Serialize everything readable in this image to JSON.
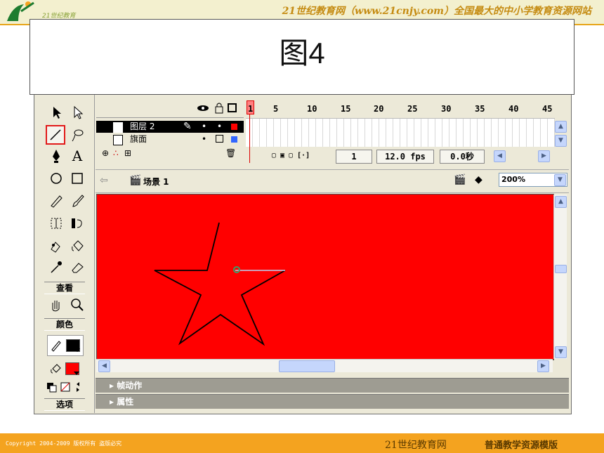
{
  "slide": {
    "banner": "21世纪教育网（www.21cnjy.com）全国最大的中小学教育资源网站",
    "logo_text": "21世纪教育",
    "figure_title": "图4",
    "footer_copyright": "Copyright 2004-2009 版权所有 盗版必究",
    "footer_site": "21世纪教育网",
    "footer_template": "普通教学资源模版"
  },
  "tools": {
    "view_label": "查看",
    "colors_label": "颜色",
    "options_label": "选项",
    "text_tool_glyph": "A",
    "stroke_color": "#000000",
    "fill_color": "#ff0000",
    "selected_tool": "line-tool"
  },
  "timeline": {
    "frame_numbers": [
      "1",
      "5",
      "10",
      "15",
      "20",
      "25",
      "30",
      "35",
      "40",
      "45"
    ],
    "layers": [
      {
        "name": "图层 2",
        "selected": true,
        "color": "#ff0000"
      },
      {
        "name": "旗面",
        "selected": false,
        "color": "#3366ff"
      }
    ],
    "current_frame": "1",
    "frame_rate": "12.0 fps",
    "elapsed_time": "0.0秒"
  },
  "editbar": {
    "scene_label": "场景 1",
    "zoom_value": "200%"
  },
  "stage": {
    "background_color": "#ff0000"
  },
  "panels": {
    "actions_label": "帧动作",
    "properties_label": "属性"
  }
}
